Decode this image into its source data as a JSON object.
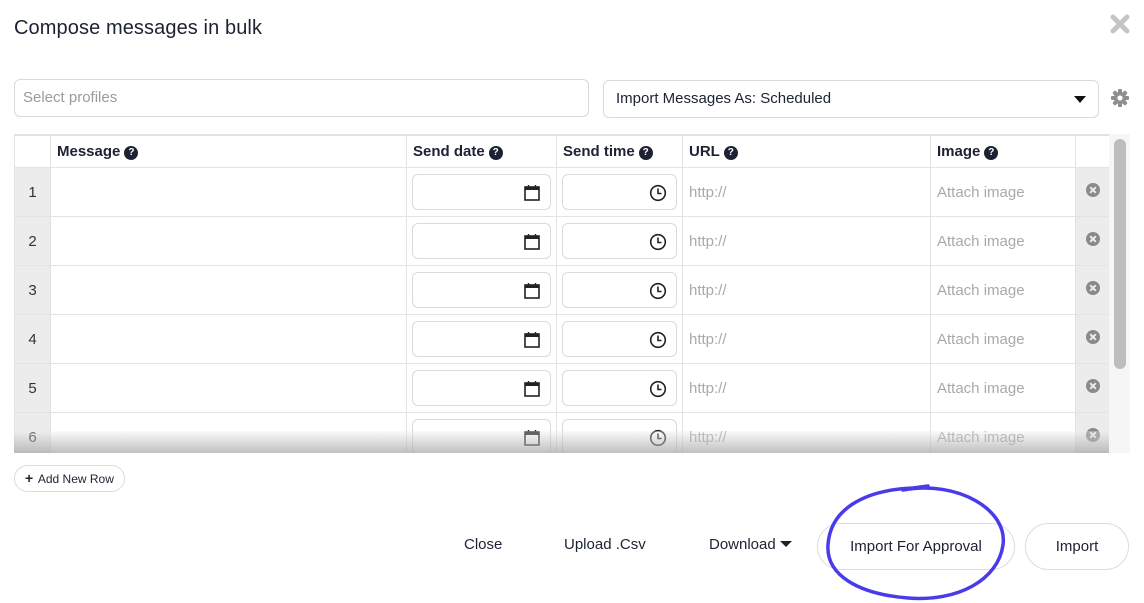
{
  "dialog": {
    "title": "Compose messages in bulk",
    "close_icon": "close-icon"
  },
  "toolbar": {
    "profiles_placeholder": "Select profiles",
    "import_as_label": "Import Messages As: Scheduled",
    "settings_icon": "gear-icon"
  },
  "grid": {
    "columns": [
      "Message",
      "Send date",
      "Send time",
      "URL",
      "Image"
    ],
    "help_icon": "?",
    "url_placeholder": "http://",
    "image_placeholder": "Attach image",
    "rows": [
      {
        "num": "1"
      },
      {
        "num": "2"
      },
      {
        "num": "3"
      },
      {
        "num": "4"
      },
      {
        "num": "5"
      },
      {
        "num": "6"
      }
    ]
  },
  "actions": {
    "add_row": "Add New Row",
    "close": "Close",
    "upload": "Upload .Csv",
    "download": "Download",
    "import_for_approval": "Import For Approval",
    "import": "Import"
  },
  "colors": {
    "annotation": "#4a3bea",
    "text": "#1d2233",
    "rownum_bg": "#ececec"
  }
}
